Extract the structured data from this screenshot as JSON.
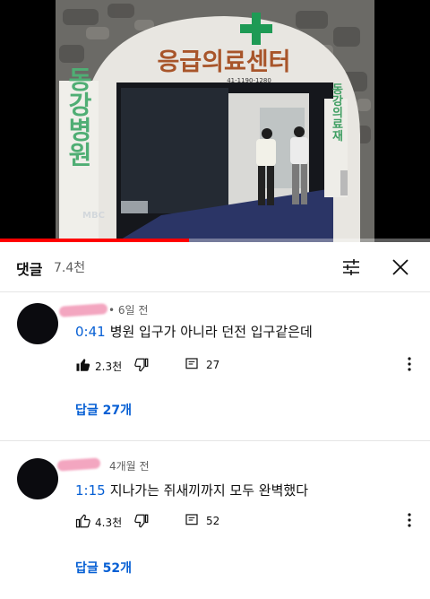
{
  "video": {
    "sign_main": "응급의료센터",
    "sign_phone": "41-1190-1280",
    "sign_left": "동강병원",
    "sign_right": "동강의료재",
    "broadcaster": "MBC",
    "progress": 0.44,
    "progress_color": "#ff0000"
  },
  "comments_panel": {
    "title": "댓글",
    "count": "7.4천",
    "sort_icon": "sort-sliders-icon",
    "close_icon": "close-icon"
  },
  "comments": [
    {
      "age": "• 6일 전",
      "timestamp": "0:41",
      "text": "병원 입구가 아니라 던전 입구같은데",
      "likes": "2.3천",
      "replies": "27",
      "replies_link": "답글 27개",
      "liked": true
    },
    {
      "age": "4개월 전",
      "timestamp": "1:15",
      "text": "지나가는 쥐새끼까지 모두 완벽했다",
      "likes": "4.3천",
      "replies": "52",
      "replies_link": "답글 52개",
      "liked": false
    }
  ],
  "colors": {
    "link_blue": "#065fd4",
    "secondary_text": "#606060",
    "divider": "#e5e5e5"
  }
}
